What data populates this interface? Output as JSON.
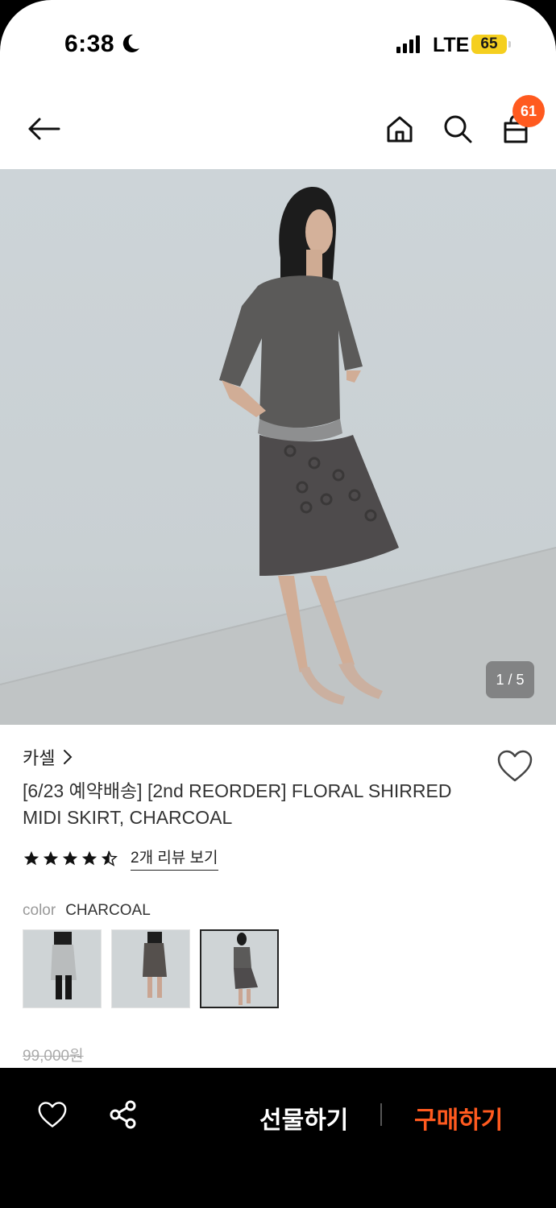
{
  "status_bar": {
    "time": "6:38",
    "network": "LTE",
    "battery": "65"
  },
  "nav": {
    "cart_count": "61"
  },
  "hero": {
    "counter": "1 / 5"
  },
  "product": {
    "brand": "카셀",
    "title": "[6/23 예약배송] [2nd REORDER] FLORAL SHIRRED MIDI SKIRT, CHARCOAL",
    "rating": 4.5,
    "review_link": "2개 리뷰 보기",
    "color_label": "color",
    "color_value": "CHARCOAL",
    "swatch_selected_index": 2,
    "original_price": "99,000원"
  },
  "bottom_bar": {
    "gift_label": "선물하기",
    "buy_label": "구매하기"
  },
  "colors": {
    "accent": "#ff5a1f",
    "battery": "#f5cf1f"
  }
}
